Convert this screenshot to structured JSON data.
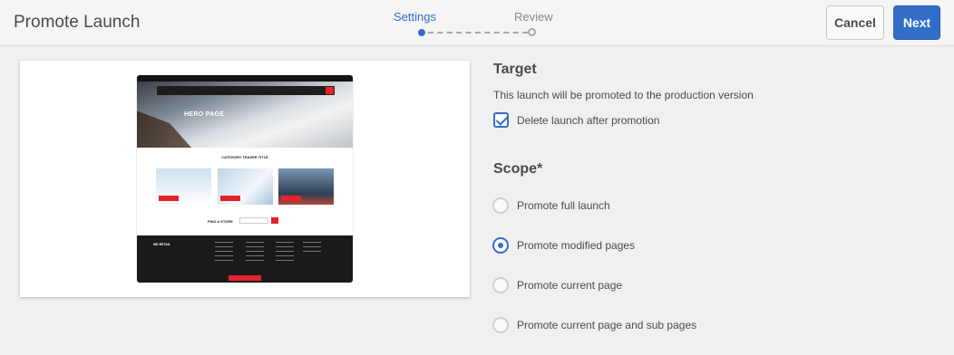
{
  "header": {
    "title": "Promote Launch",
    "steps": [
      {
        "label": "Settings",
        "active": true
      },
      {
        "label": "Review",
        "active": false
      }
    ],
    "cancel_label": "Cancel",
    "next_label": "Next"
  },
  "preview": {
    "hero_text": "HERO PAGE",
    "category_text": "CATEGORY TEASER TITLE",
    "find_text": "FIND A STORE",
    "footer_logo": "WE.RETAIL"
  },
  "target": {
    "heading": "Target",
    "description": "This launch will be promoted to the production version",
    "delete_label": "Delete launch after promotion",
    "delete_checked": true
  },
  "scope": {
    "heading": "Scope*",
    "options": [
      {
        "label": "Promote full launch",
        "selected": false
      },
      {
        "label": "Promote modified pages",
        "selected": true
      },
      {
        "label": "Promote current page",
        "selected": false
      },
      {
        "label": "Promote current page and sub pages",
        "selected": false
      }
    ]
  },
  "colors": {
    "accent": "#326ec8",
    "brand_red": "#e3222a"
  }
}
